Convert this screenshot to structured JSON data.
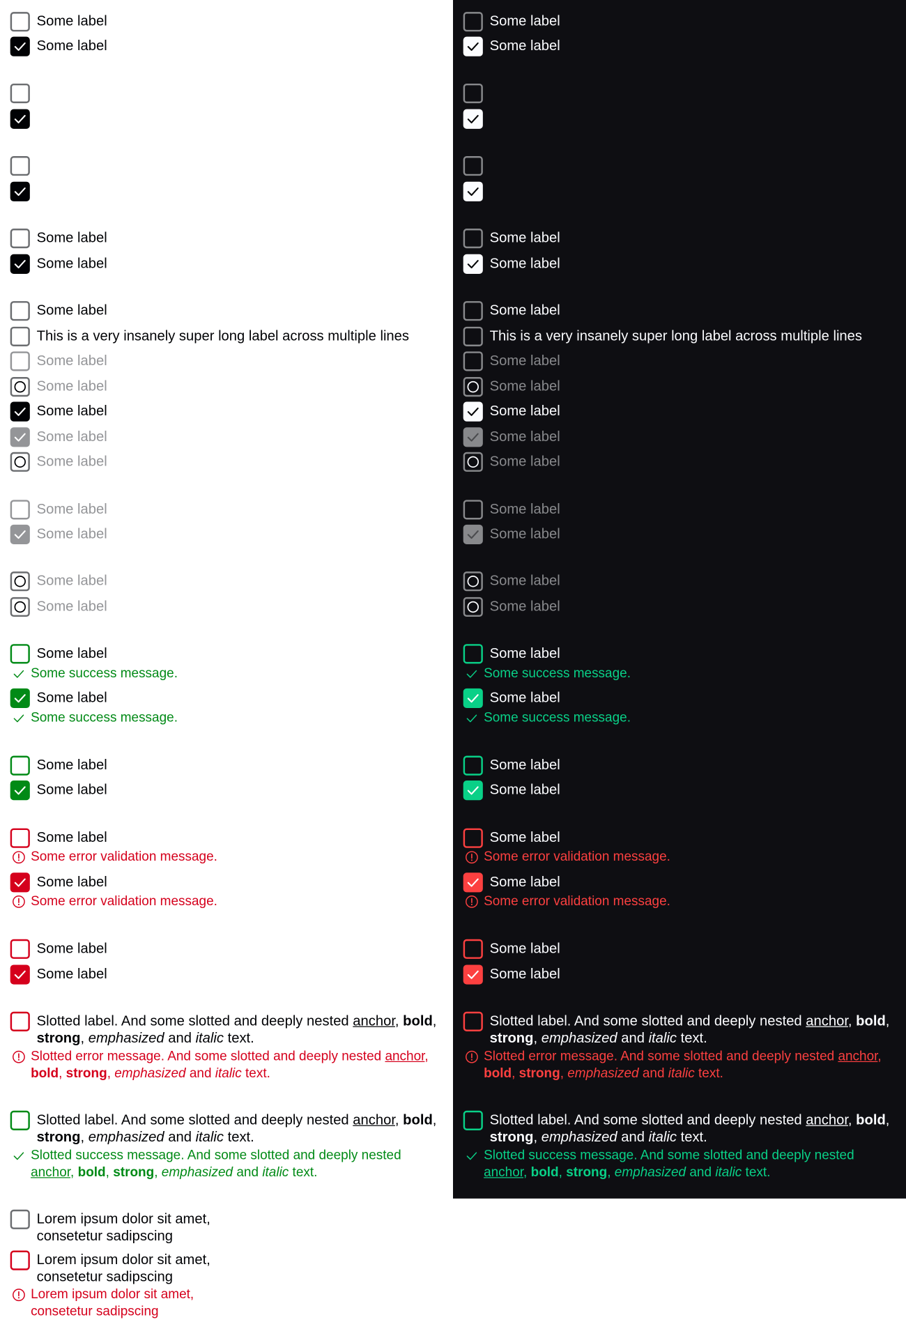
{
  "labels": {
    "some_label": "Some label",
    "long_label": "This is a very insanely super long label across multiple lines",
    "success_message": "Some success message.",
    "error_message": "Some error validation message.",
    "slotted_label": {
      "pre": "Slotted label. And some slotted and deeply nested ",
      "anchor": "anchor",
      "bold": "bold",
      "strong": "strong",
      "emphasized": "emphasized",
      "and": " and ",
      "italic": "italic",
      "post": " text."
    },
    "slotted_error": {
      "pre": "Slotted error message. And some slotted and deeply nested ",
      "anchor": "anchor",
      "bold": "bold",
      "strong": "strong",
      "emphasized": "emphasized",
      "and": " and ",
      "italic": "italic",
      "post": " text."
    },
    "slotted_success": {
      "pre": "Slotted success message. And some slotted and deeply nested ",
      "anchor": "anchor",
      "bold": "bold",
      "strong": "strong",
      "emphasized": "emphasized",
      "and": " and ",
      "italic": "italic",
      "post": " text."
    },
    "lorem_line1": "Lorem ipsum dolor sit amet,",
    "lorem_line2": "consetetur sadipscing"
  },
  "colors": {
    "light": {
      "bg": "#ffffff",
      "text": "#010205",
      "muted": "#949598",
      "border": "#6b6d70",
      "checked": "#010205",
      "check_mark": "#ffffff",
      "success": "#018a16",
      "error": "#d5001c"
    },
    "dark": {
      "bg": "#0e0e12",
      "text": "#fbfcff",
      "muted": "#88898c",
      "border": "#88898c",
      "checked": "#fbfcff",
      "check_mark": "#010205",
      "success": "#09d087",
      "error": "#fc4040"
    }
  },
  "icons": [
    "check-icon",
    "circle-loading-icon",
    "success-check-icon",
    "error-exclamation-icon"
  ],
  "rows": [
    {
      "state": "unchecked",
      "label": "some_label"
    },
    {
      "state": "checked",
      "label": "some_label"
    },
    {
      "state": "unchecked",
      "label": ""
    },
    {
      "state": "checked",
      "label": ""
    },
    {
      "state": "unchecked",
      "label": ""
    },
    {
      "state": "checked",
      "label": ""
    },
    {
      "state": "unchecked",
      "label": "some_label"
    },
    {
      "state": "checked",
      "label": "some_label"
    },
    {
      "state": "unchecked",
      "label": "some_label"
    },
    {
      "state": "unchecked",
      "label": "long_label"
    },
    {
      "state": "unchecked",
      "label": "some_label",
      "variant": "disabled"
    },
    {
      "state": "loading",
      "label": "some_label",
      "variant": "disabled"
    },
    {
      "state": "checked",
      "label": "some_label"
    },
    {
      "state": "checked",
      "label": "some_label",
      "variant": "disabled"
    },
    {
      "state": "loading",
      "label": "some_label",
      "variant": "disabled"
    },
    {
      "state": "unchecked",
      "label": "some_label",
      "variant": "disabled"
    },
    {
      "state": "checked",
      "label": "some_label",
      "variant": "disabled"
    },
    {
      "state": "loading",
      "label": "some_label",
      "variant": "disabled"
    },
    {
      "state": "loading",
      "label": "some_label",
      "variant": "disabled"
    },
    {
      "state": "unchecked",
      "label": "some_label",
      "variant": "success",
      "message": "success_message"
    },
    {
      "state": "checked",
      "label": "some_label",
      "variant": "success",
      "message": "success_message"
    },
    {
      "state": "unchecked",
      "label": "some_label",
      "variant": "success"
    },
    {
      "state": "checked",
      "label": "some_label",
      "variant": "success"
    },
    {
      "state": "unchecked",
      "label": "some_label",
      "variant": "error",
      "message": "error_message"
    },
    {
      "state": "checked",
      "label": "some_label",
      "variant": "error",
      "message": "error_message"
    },
    {
      "state": "unchecked",
      "label": "some_label",
      "variant": "error"
    },
    {
      "state": "checked",
      "label": "some_label",
      "variant": "error"
    },
    {
      "state": "unchecked",
      "label": "slotted_label",
      "variant": "error",
      "message": "slotted_error"
    },
    {
      "state": "unchecked",
      "label": "slotted_label",
      "variant": "success",
      "message": "slotted_success"
    },
    {
      "state": "unchecked",
      "label": "lorem",
      "light_only": true
    },
    {
      "state": "unchecked",
      "label": "lorem",
      "variant": "error",
      "message": "lorem",
      "light_only": true
    }
  ]
}
